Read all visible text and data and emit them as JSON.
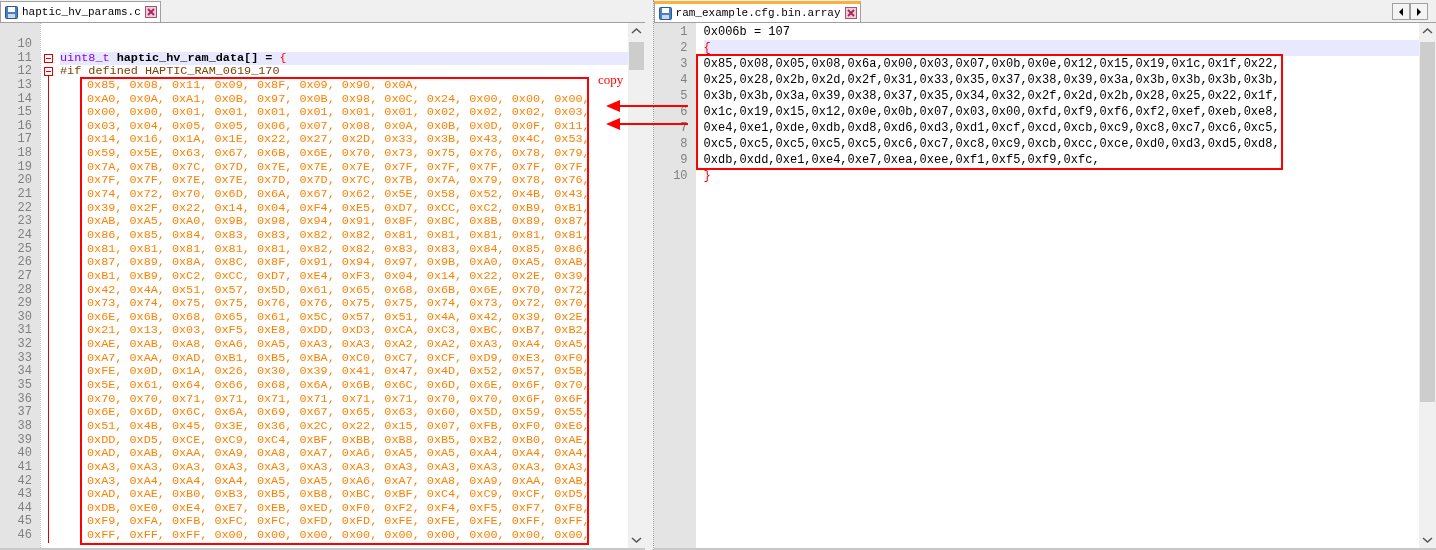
{
  "left_editor": {
    "tab": {
      "label": "haptic_hv_params.c",
      "selected": false
    },
    "lines": [
      {
        "number": "10",
        "kind": "blank",
        "current": false
      },
      {
        "number": "11",
        "kind": "code",
        "current": true,
        "folding": true,
        "tokens": [
          {
            "kind": "type",
            "text": "uint8_t"
          },
          {
            "kind": "identifier",
            "text": " haptic_hv_ram_data[] = "
          },
          {
            "kind": "brace",
            "text": "{"
          }
        ]
      },
      {
        "number": "12",
        "kind": "code",
        "current": false,
        "folding": true,
        "tokens": [
          {
            "kind": "directive",
            "text": "#if defined HAPTIC_RAM_0619_170"
          }
        ]
      }
    ],
    "highlighted_block": [
      {
        "number": "13",
        "text": "0x85, 0x08, 0x11, 0x09, 0x8F, 0x09, 0x90, 0x0A,"
      },
      {
        "number": "14",
        "text": "0xA0, 0x0A, 0xA1, 0x0B, 0x97, 0x0B, 0x98, 0x0C, 0x24, 0x00, 0x00, 0x00,"
      },
      {
        "number": "15",
        "text": "0x00, 0x00, 0x01, 0x01, 0x01, 0x01, 0x01, 0x01, 0x02, 0x02, 0x02, 0x03,"
      },
      {
        "number": "16",
        "text": "0x03, 0x04, 0x05, 0x05, 0x06, 0x07, 0x08, 0x0A, 0x0B, 0x0D, 0x0F, 0x11,"
      },
      {
        "number": "17",
        "text": "0x14, 0x16, 0x1A, 0x1E, 0x22, 0x27, 0x2D, 0x33, 0x3B, 0x43, 0x4C, 0x53,"
      },
      {
        "number": "18",
        "text": "0x59, 0x5E, 0x63, 0x67, 0x6B, 0x6E, 0x70, 0x73, 0x75, 0x76, 0x78, 0x79,"
      },
      {
        "number": "19",
        "text": "0x7A, 0x7B, 0x7C, 0x7D, 0x7E, 0x7E, 0x7E, 0x7F, 0x7F, 0x7F, 0x7F, 0x7F,"
      },
      {
        "number": "20",
        "text": "0x7F, 0x7F, 0x7E, 0x7E, 0x7D, 0x7D, 0x7C, 0x7B, 0x7A, 0x79, 0x78, 0x76,"
      },
      {
        "number": "21",
        "text": "0x74, 0x72, 0x70, 0x6D, 0x6A, 0x67, 0x62, 0x5E, 0x58, 0x52, 0x4B, 0x43,"
      },
      {
        "number": "22",
        "text": "0x39, 0x2F, 0x22, 0x14, 0x04, 0xF4, 0xE5, 0xD7, 0xCC, 0xC2, 0xB9, 0xB1,"
      },
      {
        "number": "23",
        "text": "0xAB, 0xA5, 0xA0, 0x9B, 0x98, 0x94, 0x91, 0x8F, 0x8C, 0x8B, 0x89, 0x87,"
      },
      {
        "number": "24",
        "text": "0x86, 0x85, 0x84, 0x83, 0x83, 0x82, 0x82, 0x81, 0x81, 0x81, 0x81, 0x81,"
      },
      {
        "number": "25",
        "text": "0x81, 0x81, 0x81, 0x81, 0x81, 0x82, 0x82, 0x83, 0x83, 0x84, 0x85, 0x86,"
      },
      {
        "number": "26",
        "text": "0x87, 0x89, 0x8A, 0x8C, 0x8F, 0x91, 0x94, 0x97, 0x9B, 0xA0, 0xA5, 0xAB,"
      },
      {
        "number": "27",
        "text": "0xB1, 0xB9, 0xC2, 0xCC, 0xD7, 0xE4, 0xF3, 0x04, 0x14, 0x22, 0x2E, 0x39,"
      },
      {
        "number": "28",
        "text": "0x42, 0x4A, 0x51, 0x57, 0x5D, 0x61, 0x65, 0x68, 0x6B, 0x6E, 0x70, 0x72,"
      },
      {
        "number": "29",
        "text": "0x73, 0x74, 0x75, 0x75, 0x76, 0x76, 0x75, 0x75, 0x74, 0x73, 0x72, 0x70,"
      },
      {
        "number": "30",
        "text": "0x6E, 0x6B, 0x68, 0x65, 0x61, 0x5C, 0x57, 0x51, 0x4A, 0x42, 0x39, 0x2E,"
      },
      {
        "number": "31",
        "text": "0x21, 0x13, 0x03, 0xF5, 0xE8, 0xDD, 0xD3, 0xCA, 0xC3, 0xBC, 0xB7, 0xB2,"
      },
      {
        "number": "32",
        "text": "0xAE, 0xAB, 0xA8, 0xA6, 0xA5, 0xA3, 0xA3, 0xA2, 0xA2, 0xA3, 0xA4, 0xA5,"
      },
      {
        "number": "33",
        "text": "0xA7, 0xAA, 0xAD, 0xB1, 0xB5, 0xBA, 0xC0, 0xC7, 0xCF, 0xD9, 0xE3, 0xF0,"
      },
      {
        "number": "34",
        "text": "0xFE, 0x0D, 0x1A, 0x26, 0x30, 0x39, 0x41, 0x47, 0x4D, 0x52, 0x57, 0x5B,"
      },
      {
        "number": "35",
        "text": "0x5E, 0x61, 0x64, 0x66, 0x68, 0x6A, 0x6B, 0x6C, 0x6D, 0x6E, 0x6F, 0x70,"
      },
      {
        "number": "36",
        "text": "0x70, 0x70, 0x71, 0x71, 0x71, 0x71, 0x71, 0x71, 0x70, 0x70, 0x6F, 0x6F,"
      },
      {
        "number": "37",
        "text": "0x6E, 0x6D, 0x6C, 0x6A, 0x69, 0x67, 0x65, 0x63, 0x60, 0x5D, 0x59, 0x55,"
      },
      {
        "number": "38",
        "text": "0x51, 0x4B, 0x45, 0x3E, 0x36, 0x2C, 0x22, 0x15, 0x07, 0xFB, 0xF0, 0xE6,"
      },
      {
        "number": "39",
        "text": "0xDD, 0xD5, 0xCE, 0xC9, 0xC4, 0xBF, 0xBB, 0xB8, 0xB5, 0xB2, 0xB0, 0xAE,"
      },
      {
        "number": "40",
        "text": "0xAD, 0xAB, 0xAA, 0xA9, 0xA8, 0xA7, 0xA6, 0xA5, 0xA5, 0xA4, 0xA4, 0xA4,"
      },
      {
        "number": "41",
        "text": "0xA3, 0xA3, 0xA3, 0xA3, 0xA3, 0xA3, 0xA3, 0xA3, 0xA3, 0xA3, 0xA3, 0xA3,"
      },
      {
        "number": "42",
        "text": "0xA3, 0xA4, 0xA4, 0xA4, 0xA5, 0xA5, 0xA6, 0xA7, 0xA8, 0xA9, 0xAA, 0xAB,"
      },
      {
        "number": "43",
        "text": "0xAD, 0xAE, 0xB0, 0xB3, 0xB5, 0xB8, 0xBC, 0xBF, 0xC4, 0xC9, 0xCF, 0xD5,"
      },
      {
        "number": "44",
        "text": "0xDB, 0xE0, 0xE4, 0xE7, 0xEB, 0xED, 0xF0, 0xF2, 0xF4, 0xF5, 0xF7, 0xF8,"
      },
      {
        "number": "45",
        "text": "0xF9, 0xFA, 0xFB, 0xFC, 0xFC, 0xFD, 0xFD, 0xFE, 0xFE, 0xFE, 0xFF, 0xFF,"
      },
      {
        "number": "46",
        "text": "0xFF, 0xFF, 0xFF, 0x00, 0x00, 0x00, 0x00, 0x00, 0x00, 0x00, 0x00, 0x00,"
      }
    ]
  },
  "right_editor": {
    "tab": {
      "label": "ram_example.cfg.bin.array",
      "selected": true
    },
    "lines_before": [
      {
        "number": "1",
        "kind": "code",
        "current": false,
        "tokens": [
          {
            "kind": "plain",
            "text": "0x006b = 107"
          }
        ]
      },
      {
        "number": "2",
        "kind": "code",
        "current": true,
        "tokens": [
          {
            "kind": "brace",
            "text": "{"
          }
        ]
      }
    ],
    "highlighted_block": [
      {
        "number": "3",
        "text": "0x85,0x08,0x05,0x08,0x6a,0x00,0x03,0x07,0x0b,0x0e,0x12,0x15,0x19,0x1c,0x1f,0x22,"
      },
      {
        "number": "4",
        "text": "0x25,0x28,0x2b,0x2d,0x2f,0x31,0x33,0x35,0x37,0x38,0x39,0x3a,0x3b,0x3b,0x3b,0x3b,"
      },
      {
        "number": "5",
        "text": "0x3b,0x3b,0x3a,0x39,0x38,0x37,0x35,0x34,0x32,0x2f,0x2d,0x2b,0x28,0x25,0x22,0x1f,"
      },
      {
        "number": "6",
        "text": "0x1c,0x19,0x15,0x12,0x0e,0x0b,0x07,0x03,0x00,0xfd,0xf9,0xf6,0xf2,0xef,0xeb,0xe8,"
      },
      {
        "number": "7",
        "text": "0xe4,0xe1,0xde,0xdb,0xd8,0xd6,0xd3,0xd1,0xcf,0xcd,0xcb,0xc9,0xc8,0xc7,0xc6,0xc5,"
      },
      {
        "number": "8",
        "text": "0xc5,0xc5,0xc5,0xc5,0xc5,0xc6,0xc7,0xc8,0xc9,0xcb,0xcc,0xce,0xd0,0xd3,0xd5,0xd8,"
      },
      {
        "number": "9",
        "text": "0xdb,0xdd,0xe1,0xe4,0xe7,0xea,0xee,0xf1,0xf5,0xf9,0xfc,"
      }
    ],
    "lines_after": [
      {
        "number": "10",
        "kind": "code",
        "current": false,
        "tokens": [
          {
            "kind": "brace",
            "text": "}"
          }
        ]
      }
    ]
  },
  "annotation": {
    "label": "copy"
  }
}
